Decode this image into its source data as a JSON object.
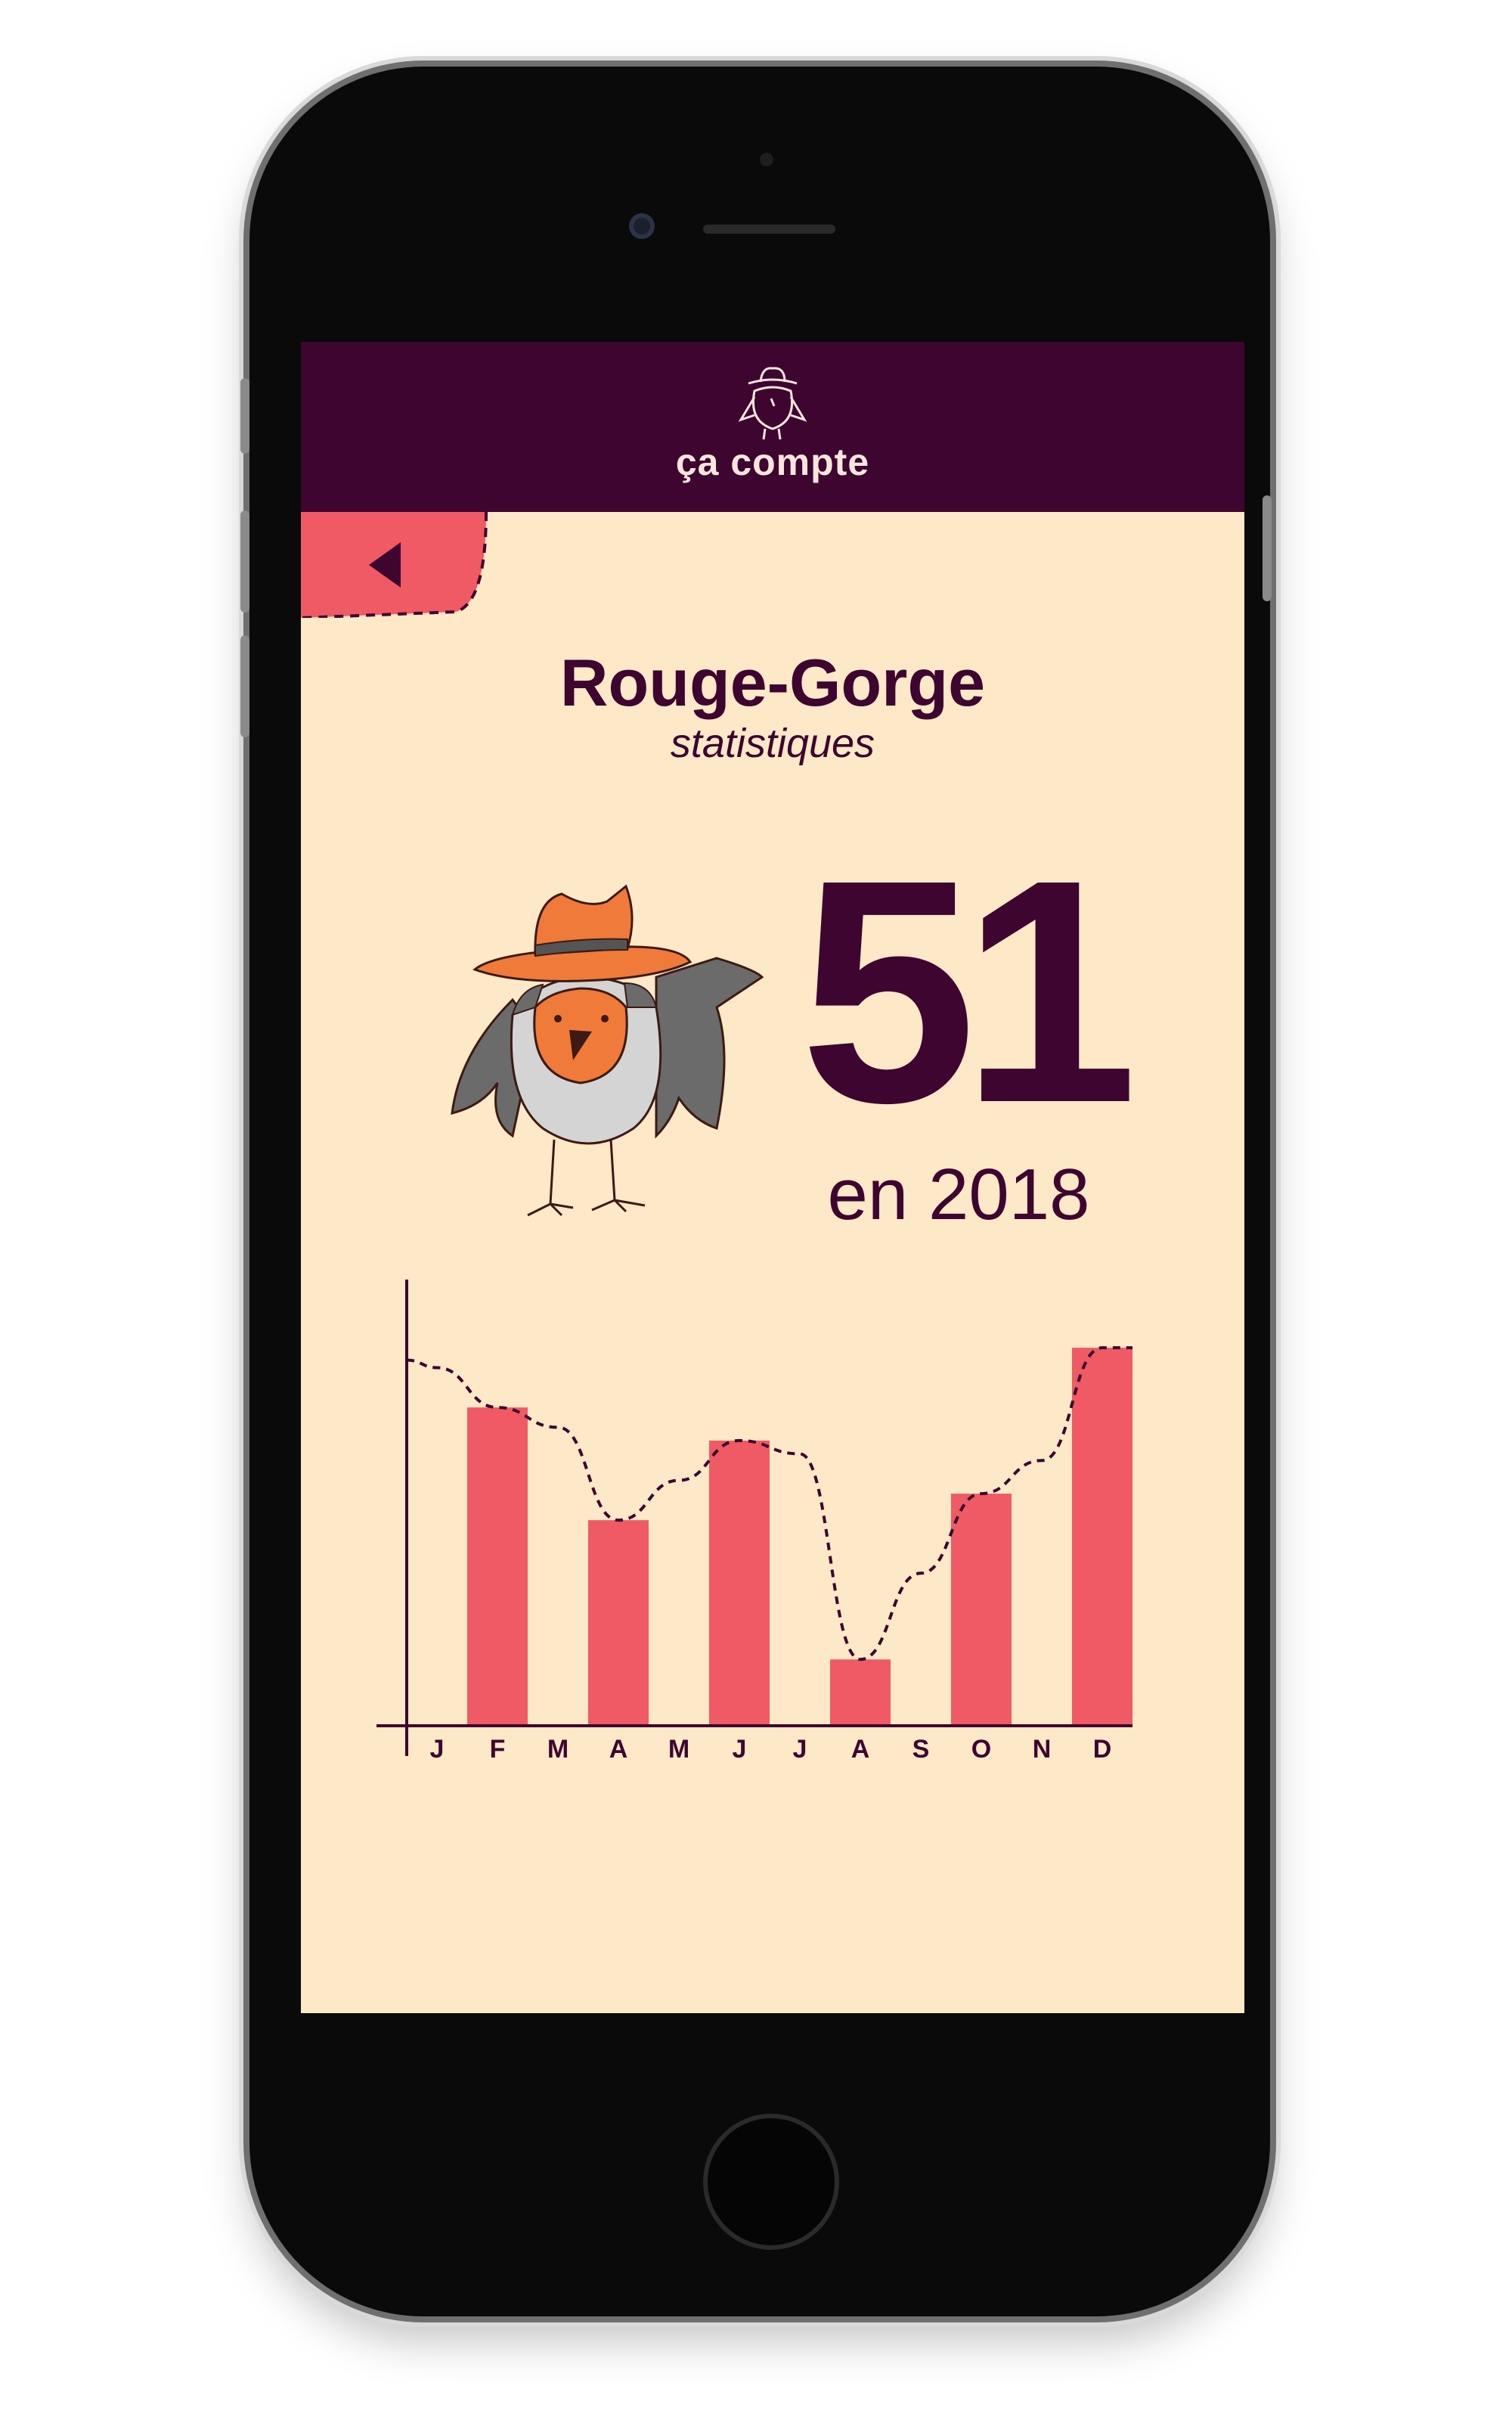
{
  "app": {
    "title": "ça compte"
  },
  "nav": {
    "back_icon": "back-arrow-icon"
  },
  "species": {
    "name": "Rouge-Gorge",
    "subtitle": "statistiques"
  },
  "summary": {
    "count": "51",
    "year_label": "en 2018"
  },
  "colors": {
    "header": "#3d0530",
    "background": "#fde8c8",
    "bar": "#f05a64",
    "text": "#3d0530",
    "bird_orange": "#f07a3a",
    "bird_gray": "#6b6b6b"
  },
  "chart_data": {
    "type": "bar",
    "categories": [
      "J",
      "F",
      "M",
      "A",
      "M",
      "J",
      "J",
      "A",
      "S",
      "O",
      "N",
      "D"
    ],
    "values": [
      5.4,
      4.8,
      4.5,
      3.1,
      3.7,
      4.3,
      4.1,
      1.0,
      2.3,
      3.5,
      4.0,
      5.7
    ],
    "visible_bar_indices": [
      1,
      3,
      5,
      7,
      9,
      11
    ],
    "trend_line": "dashed",
    "ylim": [
      0,
      6.5
    ],
    "grid": false
  }
}
